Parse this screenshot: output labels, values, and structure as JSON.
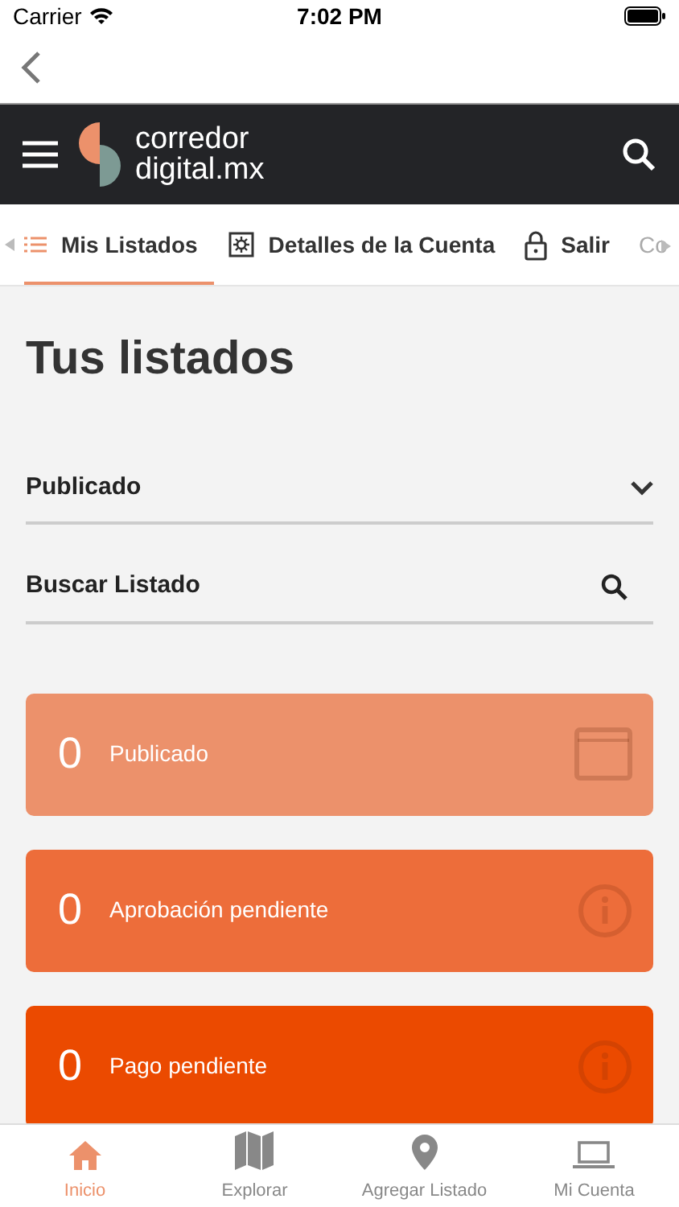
{
  "status_bar": {
    "carrier": "Carrier",
    "time": "7:02 PM"
  },
  "header": {
    "logo_line_1": "corredor",
    "logo_line_2": "digital.mx"
  },
  "tabs": [
    {
      "label": "Mis Listados",
      "selected": true
    },
    {
      "label": "Detalles de la Cuenta",
      "selected": false
    },
    {
      "label": "Salir",
      "selected": false
    },
    {
      "label": "Co",
      "selected": false
    }
  ],
  "title": "Tus listados",
  "filter": {
    "value": "Publicado"
  },
  "search": {
    "placeholder": "Buscar Listado"
  },
  "cards": [
    {
      "count": "0",
      "label": "Publicado",
      "color": "#ec916b",
      "kind": "window"
    },
    {
      "count": "0",
      "label": "Aprobación pendiente",
      "color": "#ed6d3a",
      "kind": "info"
    },
    {
      "count": "0",
      "label": "Pago pendiente",
      "color": "#eb4a00",
      "kind": "info"
    }
  ],
  "bottom_nav": [
    {
      "label": "Inicio",
      "selected": true
    },
    {
      "label": "Explorar",
      "selected": false
    },
    {
      "label": "Agregar Listado",
      "selected": false
    },
    {
      "label": "Mi Cuenta",
      "selected": false
    }
  ]
}
